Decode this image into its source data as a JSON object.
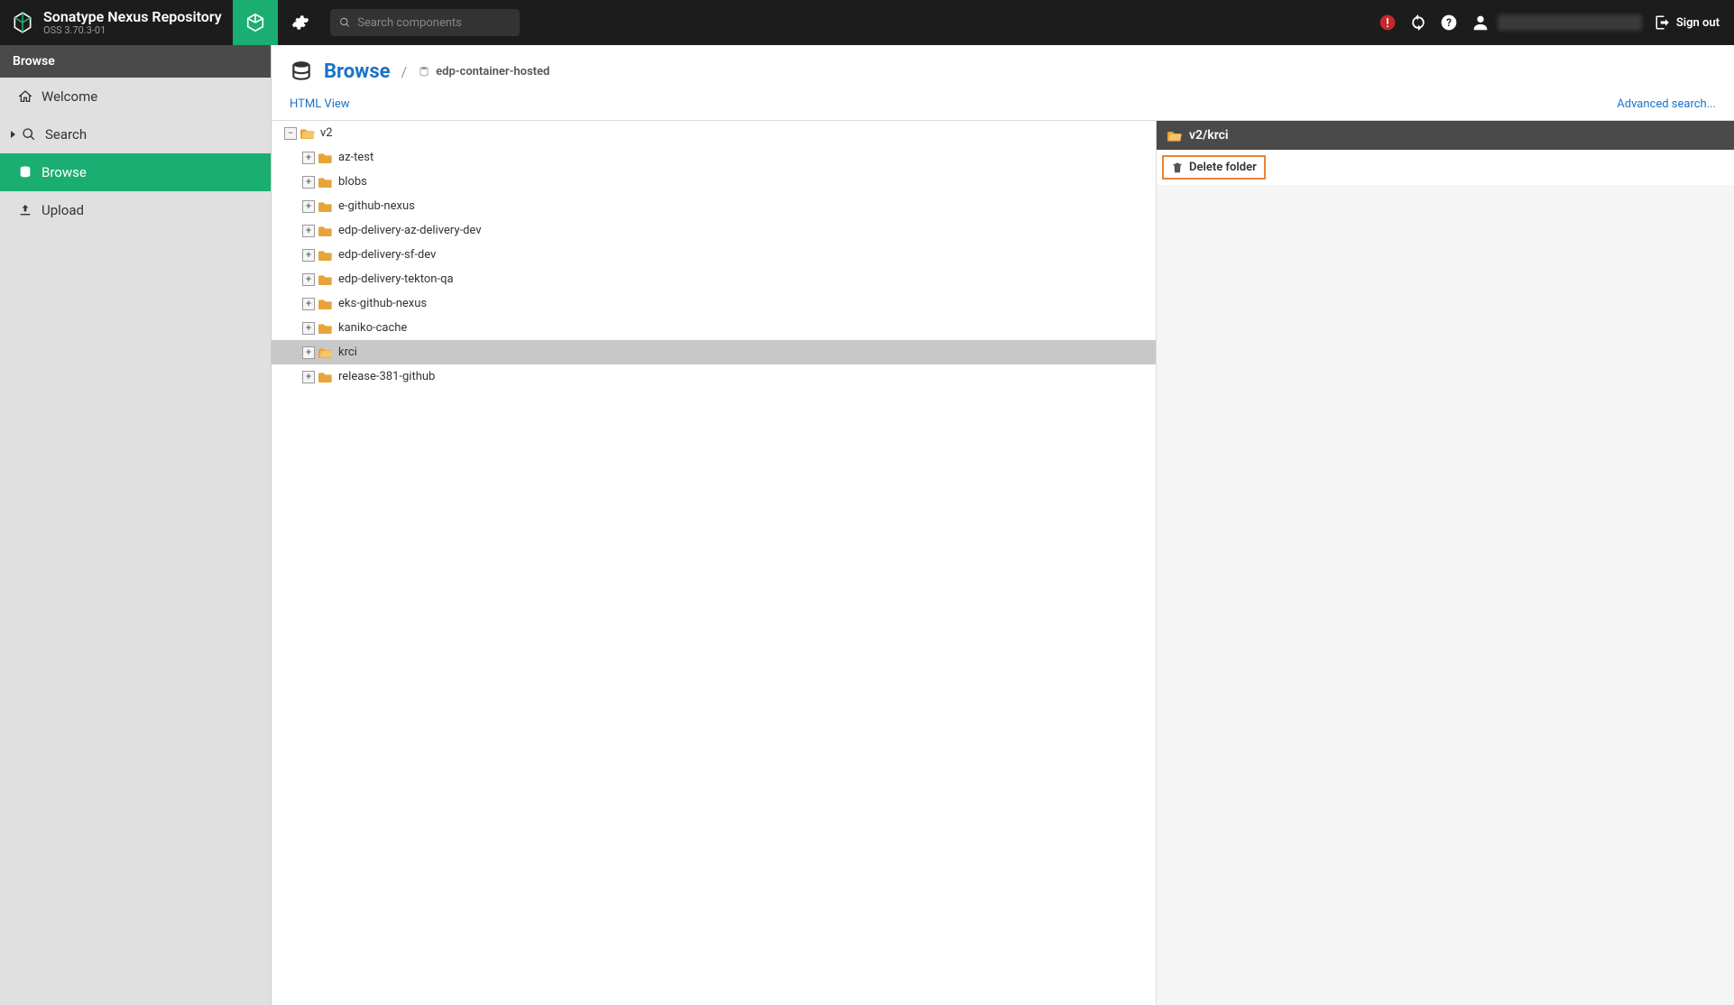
{
  "header": {
    "title": "Sonatype Nexus Repository",
    "subtitle": "OSS 3.70.3-01",
    "search_placeholder": "Search components",
    "signout": "Sign out"
  },
  "sidebar": {
    "title": "Browse",
    "items": [
      {
        "label": "Welcome"
      },
      {
        "label": "Search"
      },
      {
        "label": "Browse"
      },
      {
        "label": "Upload"
      }
    ]
  },
  "content": {
    "breadcrumb": {
      "section": "Browse",
      "repo": "edp-container-hosted"
    },
    "links": {
      "html_view": "HTML View",
      "advanced_search": "Advanced search..."
    },
    "tree": {
      "root": "v2",
      "children": [
        {
          "label": "az-test"
        },
        {
          "label": "blobs"
        },
        {
          "label": "e-github-nexus"
        },
        {
          "label": "edp-delivery-az-delivery-dev"
        },
        {
          "label": "edp-delivery-sf-dev"
        },
        {
          "label": "edp-delivery-tekton-qa"
        },
        {
          "label": "eks-github-nexus"
        },
        {
          "label": "kaniko-cache"
        },
        {
          "label": "krci",
          "selected": true
        },
        {
          "label": "release-381-github"
        }
      ]
    },
    "detail": {
      "path": "v2/krci",
      "delete_label": "Delete folder"
    }
  }
}
